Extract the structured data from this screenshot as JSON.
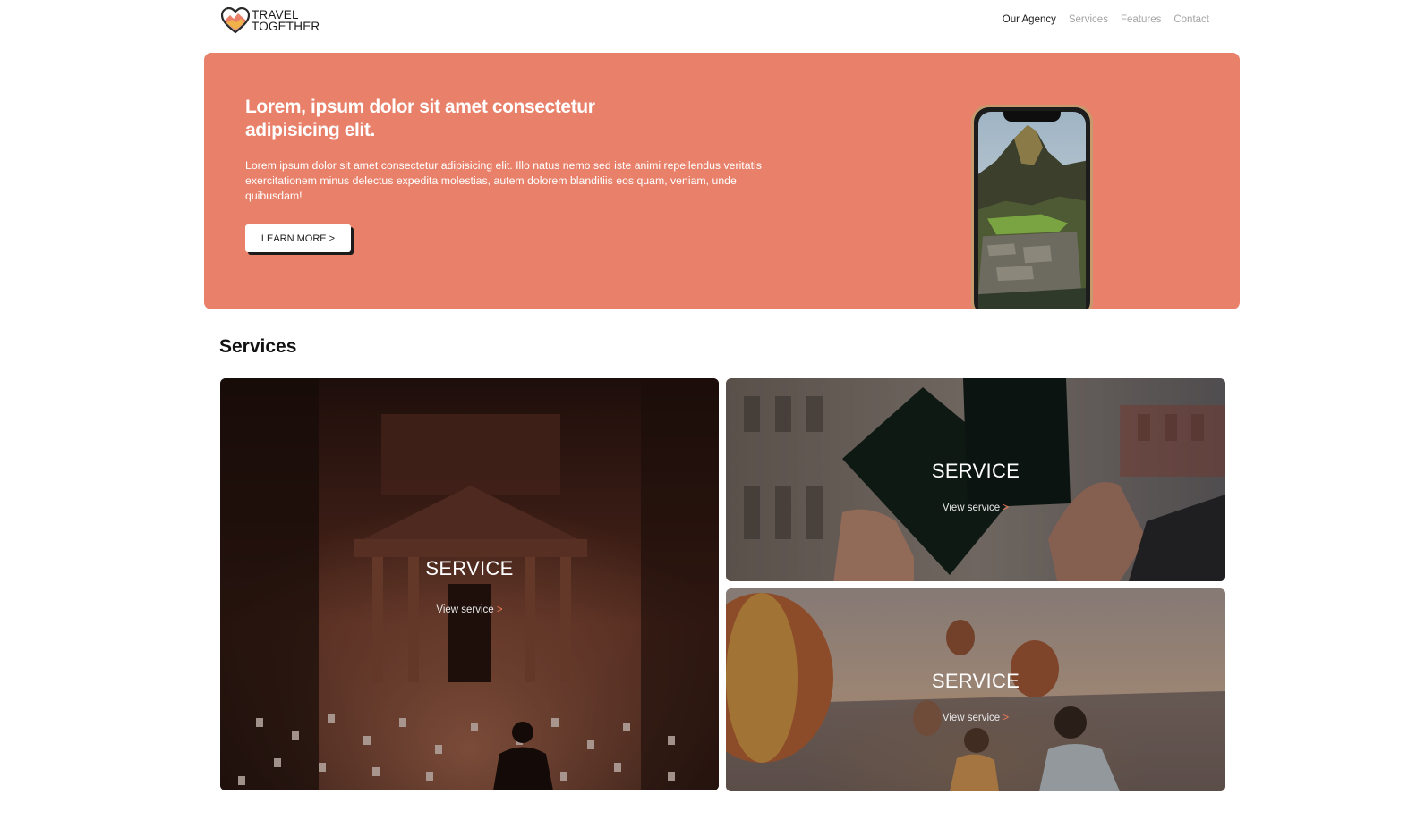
{
  "brand": {
    "line1": "TRAVEL",
    "line2": "TOGETHER",
    "icon": "heart-mountain-logo"
  },
  "nav": {
    "items": [
      {
        "label": "Our Agency",
        "active": true
      },
      {
        "label": "Services",
        "active": false
      },
      {
        "label": "Features",
        "active": false
      },
      {
        "label": "Contact",
        "active": false
      }
    ]
  },
  "hero": {
    "title": "Lorem, ipsum dolor sit amet consectetur adipisicing elit.",
    "text": "Lorem ipsum dolor sit amet consectetur adipisicing elit. Illo natus nemo sed iste animi repellendus veritatis exercitationem minus delectus expedita molestias, autem dolorem blanditiis eos quam, veniam, unde quibusdam!",
    "button": "LEARN MORE >",
    "background_color": "#e8806a",
    "phone_image": "mountain-ruins-photo"
  },
  "services": {
    "heading": "Services",
    "cards": [
      {
        "title": "SERVICE",
        "link": "View service",
        "arrow": ">",
        "image": "petra-treasury-candles-photo"
      },
      {
        "title": "SERVICE",
        "link": "View service",
        "arrow": ">",
        "image": "passports-in-hands-photo"
      },
      {
        "title": "SERVICE",
        "link": "View service",
        "arrow": ">",
        "image": "hot-air-balloons-couple-photo"
      }
    ]
  },
  "colors": {
    "accent": "#e8806a",
    "link_arrow": "#f07a5a",
    "nav_inactive": "#a4a4a4",
    "text_dark": "#1b1b1b"
  }
}
